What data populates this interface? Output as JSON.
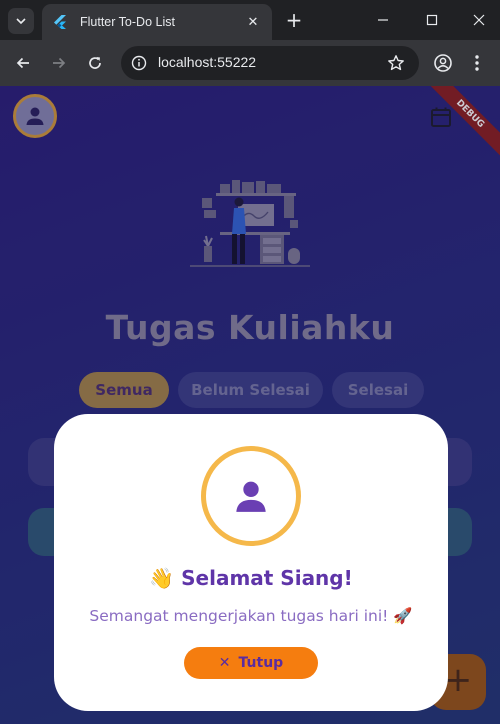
{
  "browser": {
    "tab_title": "Flutter To-Do List",
    "url": "localhost:55222",
    "new_tab_symbol": "+",
    "tab_close_symbol": "✕"
  },
  "app": {
    "debug_banner": "DEBUG",
    "title": "Tugas Kuliahku",
    "filters": [
      {
        "label": "Semua",
        "active": true
      },
      {
        "label": "Belum Selesai",
        "active": false
      },
      {
        "label": "Selesai",
        "active": false
      }
    ],
    "fab_symbol": "+"
  },
  "dialog": {
    "wave_emoji": "👋",
    "greeting": "Selamat Siang!",
    "message": "Semangat mengerjakan tugas hari ini! 🚀",
    "close_icon": "✕",
    "close_label": "Tutup"
  },
  "colors": {
    "accent_purple": "#5f35a8",
    "accent_orange": "#f57d0f",
    "ring_gold": "#f5b84a"
  },
  "icons": [
    "tab-search-icon",
    "flutter-logo-icon",
    "back-arrow-icon",
    "forward-arrow-icon",
    "reload-icon",
    "site-info-icon",
    "bookmark-star-icon",
    "profile-icon",
    "more-menu-icon",
    "person-icon",
    "calendar-icon"
  ]
}
